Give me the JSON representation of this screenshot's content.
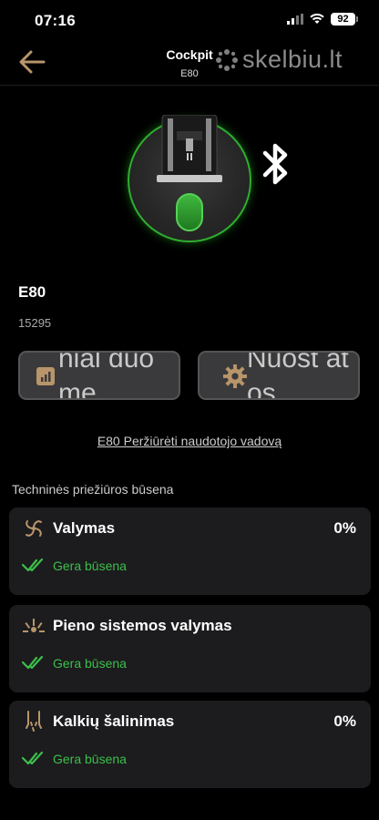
{
  "status_bar": {
    "time": "07:16",
    "battery": "92"
  },
  "header": {
    "title": "Cockpit",
    "subtitle": "E80",
    "watermark": "skelbiu.lt"
  },
  "device": {
    "name": "E80",
    "serial": "15295"
  },
  "actions": [
    {
      "label": "nial duome",
      "icon": "bar-chart-icon"
    },
    {
      "label": "Nuost atos",
      "icon": "gear-icon"
    }
  ],
  "manual_link": "E80 Peržiūrėti naudotojo vadovą",
  "maintenance": {
    "title": "Techninės priežiūros būsena",
    "items": [
      {
        "title": "Valymas",
        "percent": "0%",
        "status": "Gera būsena",
        "icon": "cleaning-icon"
      },
      {
        "title": "Pieno sistemos valymas",
        "percent": "",
        "status": "Gera būsena",
        "icon": "milk-cleaning-icon"
      },
      {
        "title": "Kalkių šalinimas",
        "percent": "0%",
        "status": "Gera būsena",
        "icon": "descaling-icon"
      }
    ]
  },
  "colors": {
    "accent_gold": "#b8956a",
    "status_green": "#3cbf4a",
    "ring_green": "#2fae2f",
    "card_bg": "#1c1c1e"
  }
}
